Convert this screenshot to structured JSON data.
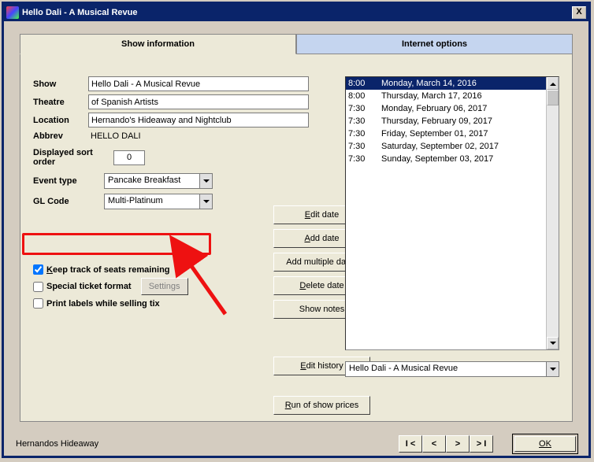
{
  "window": {
    "title": "Hello Dali - A Musical Revue"
  },
  "tabs": {
    "info": "Show information",
    "internet": "Internet options"
  },
  "labels": {
    "show": "Show",
    "theatre": "Theatre",
    "location": "Location",
    "abbrev": "Abbrev",
    "sortorder": "Displayed sort order",
    "eventtype": "Event type",
    "glcode": "GL Code"
  },
  "fields": {
    "show": "Hello Dali - A Musical Revue",
    "theatre": "of Spanish Artists",
    "location": "Hernando's Hideaway and Nightclub",
    "abbrev": "HELLO DALI",
    "sortorder": "0",
    "eventtype": "Pancake Breakfast",
    "glcode": "Multi-Platinum"
  },
  "buttons": {
    "editdate": [
      "E",
      "dit date"
    ],
    "adddate": [
      "A",
      "dd date"
    ],
    "addmulti": "Add multiple dates",
    "deldate": [
      "D",
      "elete date"
    ],
    "shownotes": "Show notes",
    "edithist": [
      "E",
      "dit history"
    ],
    "runprices": [
      "R",
      "un of show prices"
    ],
    "settings": "Settings",
    "ok": "OK",
    "nav": [
      "I <",
      "<",
      ">",
      "> I"
    ]
  },
  "checks": {
    "keeptrack": [
      "K",
      "eep track of seats remaining"
    ],
    "special": "Special ticket format",
    "printlabels": "Print labels while selling tix"
  },
  "dates": [
    {
      "t": "8:00",
      "d": "Monday, March 14, 2016",
      "sel": true
    },
    {
      "t": "8:00",
      "d": "Thursday, March 17, 2016"
    },
    {
      "t": "7:30",
      "d": "Monday, February 06, 2017"
    },
    {
      "t": "7:30",
      "d": "Thursday, February 09, 2017"
    },
    {
      "t": "7:30",
      "d": "Friday, September 01, 2017"
    },
    {
      "t": "7:30",
      "d": "Saturday, September 02, 2017"
    },
    {
      "t": "7:30",
      "d": "Sunday, September 03, 2017"
    }
  ],
  "bottomcombo": "Hello Dali - A Musical Revue",
  "footer": {
    "status": "Hernandos Hideaway"
  }
}
